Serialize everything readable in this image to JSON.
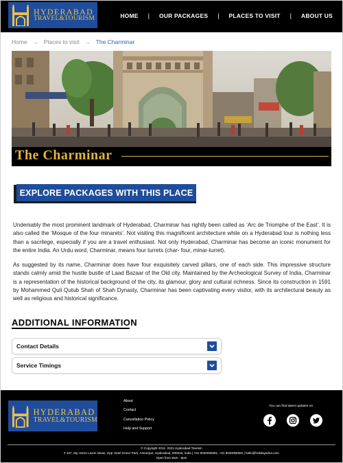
{
  "brand": {
    "line1": "HYDERABAD",
    "line2": "TRAVEL&TOURISM"
  },
  "nav": {
    "items": [
      {
        "label": "HOME"
      },
      {
        "label": "OUR PACKAGES"
      },
      {
        "label": "PLACES TO VISIT"
      },
      {
        "label": "ABOUT US"
      }
    ],
    "separator": "|"
  },
  "breadcrumb": {
    "items": [
      "Home",
      "Places to visit",
      "The Charminar"
    ],
    "arrow": "→"
  },
  "hero": {
    "title": "The Charminar"
  },
  "cta": {
    "label": "EXPLORE PACKAGES WITH THIS PLACE"
  },
  "description": {
    "p1": "Undeniably the most prominent landmark of Hyderabad, Charminar has rightly been called as ‘Arc de Triomphe of the East’. It is also called the ‘Mosque of the four minarets’. Not visiting this magnificent architecture while on a Hyderabad tour is nothing less than a sacrilege, especially if you are a travel enthusiast. Not only Hyderabad, Charminar has become an iconic monument for the entire India. An Urdu word, Charminar, means four turrets (char- four, minar-turret).",
    "p2": "As suggested by its name, Charminar does have four exquisitely carved pillars, one of each side. This impressive structure stands calmly amid the hustle bustle of Laad Bazaar of the Old city. Maintained by the Archeological Survey of India, Charminar is a representation of the historical background of the city, its glamour, glory and cultural richness. Since its construction in 1591 by Mohammed Quli Qutub Shah of Shah Dynasty, Charminar has been captivating every visitor, with its architectural beauty as well as religious and historical significance."
  },
  "additional": {
    "title": "ADDITIONAL INFORMATION",
    "sections": [
      {
        "label": "Contact Details"
      },
      {
        "label": "Service Timings"
      }
    ]
  },
  "footer": {
    "links": [
      "About",
      "Contact",
      "Cancellation Policy",
      "Help and Support"
    ],
    "follow_text": "You can find latest updates on",
    "social_icons": [
      "facebook-icon",
      "instagram-icon",
      "twitter-icon"
    ],
    "copyright": "© Copyright 2011- 2021 Hyderabad Tourism",
    "address": "# 107, My Home Laxmi Nivas, Opp Hotel Green Park, Ameerpet, Hyderabad, 500016, India | +91 9030055591, +91 9030055592 | hello@holidaysdna.com",
    "hours": "Open from 9am - 9pm"
  },
  "colors": {
    "brand_blue": "#1f4d9c",
    "gold": "#e0b43d",
    "header_bg": "#000000"
  }
}
